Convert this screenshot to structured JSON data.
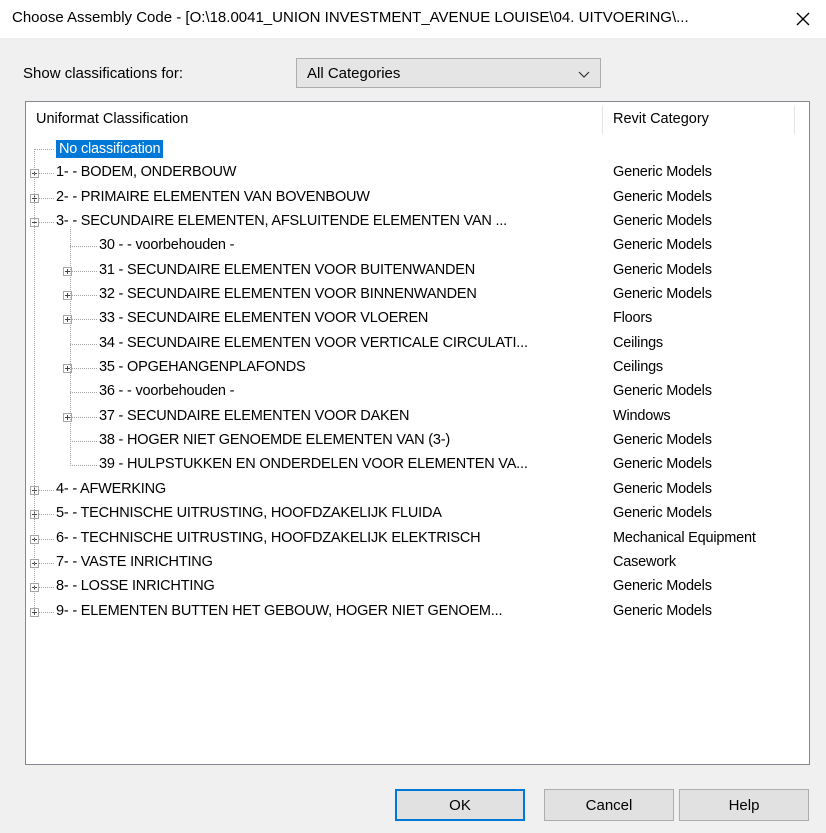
{
  "window": {
    "title": "Choose Assembly Code - [O:\\18.0041_UNION INVESTMENT_AVENUE LOUISE\\04. UITVOERING\\...",
    "close_icon": "close-icon"
  },
  "filter": {
    "label": "Show classifications for:",
    "value": "All Categories"
  },
  "tree": {
    "columns": [
      "Uniformat Classification",
      "Revit Category"
    ],
    "rows": [
      {
        "code": "No classification",
        "category": "",
        "level": 0,
        "expander": "none",
        "selected": true
      },
      {
        "code": "1- - BODEM, ONDERBOUW",
        "category": "Generic Models",
        "level": 0,
        "expander": "plus"
      },
      {
        "code": "2- - PRIMAIRE ELEMENTEN VAN BOVENBOUW",
        "category": "Generic Models",
        "level": 0,
        "expander": "plus"
      },
      {
        "code": "3- - SECUNDAIRE ELEMENTEN, AFSLUITENDE ELEMENTEN VAN ...",
        "category": "Generic Models",
        "level": 0,
        "expander": "minus"
      },
      {
        "code": "30 - - voorbehouden -",
        "category": "Generic Models",
        "level": 1,
        "expander": "none"
      },
      {
        "code": "31 - SECUNDAIRE ELEMENTEN VOOR BUITENWANDEN",
        "category": "Generic Models",
        "level": 1,
        "expander": "plus"
      },
      {
        "code": "32 - SECUNDAIRE ELEMENTEN VOOR BINNENWANDEN",
        "category": "Generic Models",
        "level": 1,
        "expander": "plus"
      },
      {
        "code": "33 - SECUNDAIRE ELEMENTEN VOOR VLOEREN",
        "category": "Floors",
        "level": 1,
        "expander": "plus"
      },
      {
        "code": "34 - SECUNDAIRE ELEMENTEN VOOR VERTICALE CIRCULATI...",
        "category": "Ceilings",
        "level": 1,
        "expander": "none"
      },
      {
        "code": "35 - OPGEHANGENPLAFONDS",
        "category": "Ceilings",
        "level": 1,
        "expander": "plus"
      },
      {
        "code": "36 - - voorbehouden -",
        "category": "Generic Models",
        "level": 1,
        "expander": "none"
      },
      {
        "code": "37 - SECUNDAIRE ELEMENTEN VOOR DAKEN",
        "category": "Windows",
        "level": 1,
        "expander": "plus"
      },
      {
        "code": "38 - HOGER NIET GENOEMDE ELEMENTEN VAN (3-)",
        "category": "Generic Models",
        "level": 1,
        "expander": "none"
      },
      {
        "code": "39 - HULPSTUKKEN EN ONDERDELEN VOOR ELEMENTEN VA...",
        "category": "Generic Models",
        "level": 1,
        "expander": "none"
      },
      {
        "code": "4- - AFWERKING",
        "category": "Generic Models",
        "level": 0,
        "expander": "plus"
      },
      {
        "code": "5- - TECHNISCHE UITRUSTING, HOOFDZAKELIJK FLUIDA",
        "category": "Generic Models",
        "level": 0,
        "expander": "plus"
      },
      {
        "code": "6- - TECHNISCHE UITRUSTING, HOOFDZAKELIJK ELEKTRISCH",
        "category": "Mechanical Equipment",
        "level": 0,
        "expander": "plus"
      },
      {
        "code": "7- - VASTE INRICHTING",
        "category": "Casework",
        "level": 0,
        "expander": "plus"
      },
      {
        "code": "8- - LOSSE INRICHTING",
        "category": "Generic Models",
        "level": 0,
        "expander": "plus"
      },
      {
        "code": "9- - ELEMENTEN BUTTEN HET GEBOUW, HOGER NIET GENOEM...",
        "category": "Generic Models",
        "level": 0,
        "expander": "plus"
      }
    ]
  },
  "buttons": {
    "ok": "OK",
    "cancel": "Cancel",
    "help": "Help"
  },
  "colors": {
    "selection": "#0078d7",
    "default_button_border": "#0078d7",
    "dialog_background": "#f0f0f0"
  }
}
